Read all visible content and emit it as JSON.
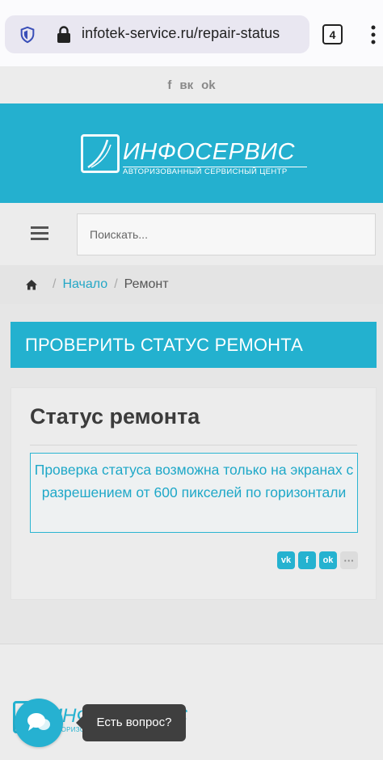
{
  "browser": {
    "url": "infotek-service.ru/repair-status",
    "tab_count": "4"
  },
  "social_top": [
    "f",
    "вк",
    "ok"
  ],
  "brand": {
    "name": "ИНФОСЕРВИС",
    "subtitle": "АВТОРИЗОВАННЫЙ СЕРВИСНЫЙ ЦЕНТР",
    "footer_name": "ИНФОСЕРВИС",
    "footer_subtitle": "АВТОРИЗОВАННЫЙ СЕРВИСНЫЙ ЦЕНТР"
  },
  "search": {
    "placeholder": "Поискать..."
  },
  "breadcrumb": {
    "sep": "/",
    "home_link": "Начало",
    "current": "Ремонт"
  },
  "page": {
    "heading": "ПРОВЕРИТЬ СТАТУС РЕМОНТА",
    "card_title": "Статус ремонта",
    "notice": "Проверка статуса возможна только на экранах с разрешением от 600 пикселей по горизонтали"
  },
  "share": [
    "vk",
    "f",
    "ok",
    "···"
  ],
  "chat": {
    "tooltip": "Есть вопрос?"
  },
  "colors": {
    "accent": "#24b0cf",
    "text": "#3b3b3b"
  }
}
